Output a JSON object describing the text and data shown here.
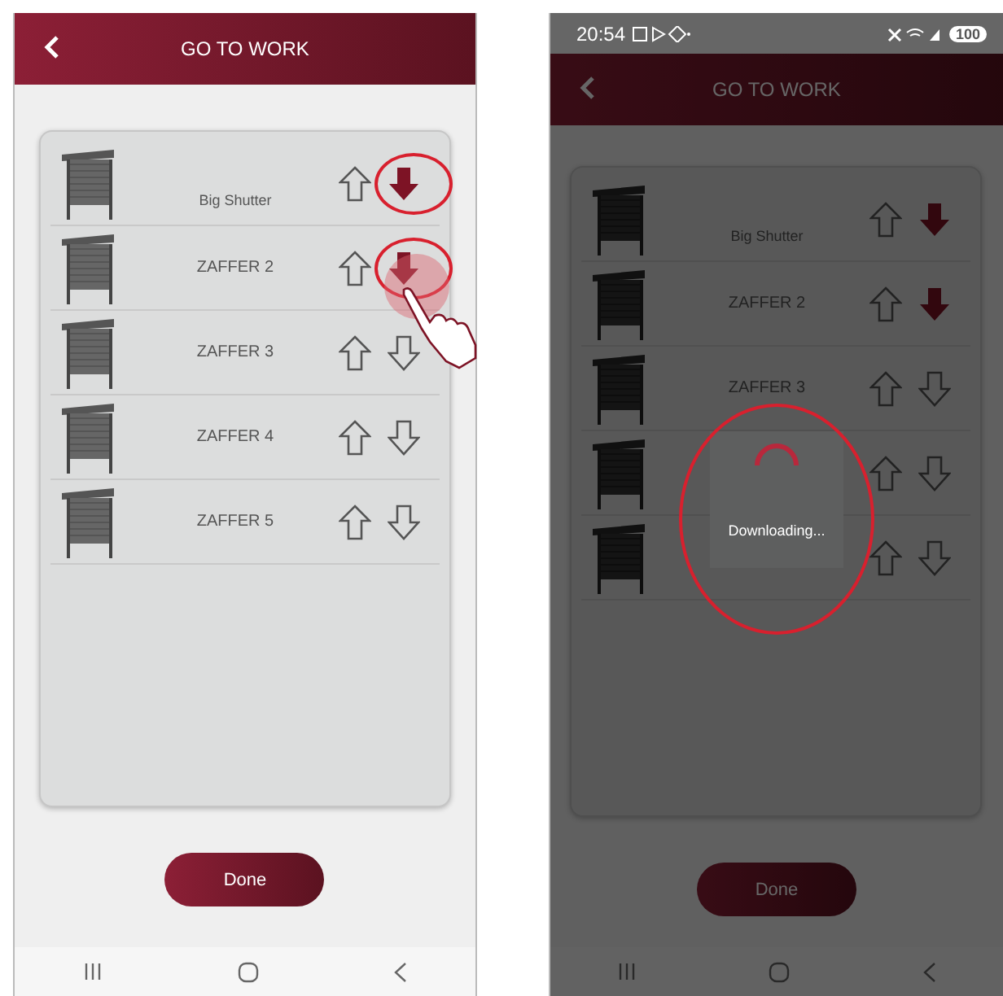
{
  "screens": [
    {
      "title": "GO TO WORK",
      "dimmed": false,
      "done": "Done",
      "shutters": [
        {
          "name": "Big Shutter",
          "kind": "small",
          "down_active": true,
          "highlighted": true,
          "tapped": false
        },
        {
          "name": "ZAFFER 2",
          "kind": "normal",
          "down_active": true,
          "highlighted": true,
          "tapped": true
        },
        {
          "name": "ZAFFER 3",
          "kind": "normal",
          "down_active": false,
          "highlighted": false,
          "tapped": false
        },
        {
          "name": "ZAFFER 4",
          "kind": "normal",
          "down_active": false,
          "highlighted": false,
          "tapped": false
        },
        {
          "name": "ZAFFER 5",
          "kind": "normal",
          "down_active": false,
          "highlighted": false,
          "tapped": false
        }
      ]
    },
    {
      "status_bar": {
        "time": "20:54",
        "battery": "100"
      },
      "title": "GO TO WORK",
      "dimmed": true,
      "done": "Done",
      "dialog": {
        "text": "Downloading...",
        "highlighted": true
      },
      "shutters": [
        {
          "name": "Big Shutter",
          "kind": "small",
          "down_active": true,
          "highlighted": false,
          "tapped": false
        },
        {
          "name": "ZAFFER 2",
          "kind": "normal",
          "down_active": true,
          "highlighted": false,
          "tapped": false
        },
        {
          "name": "ZAFFER 3",
          "kind": "normal",
          "down_active": false,
          "highlighted": false,
          "tapped": false
        },
        {
          "kind": "normal",
          "down_active": false,
          "highlighted": false,
          "tapped": false
        },
        {
          "kind": "normal",
          "down_active": false,
          "highlighted": false,
          "tapped": false
        }
      ]
    }
  ]
}
